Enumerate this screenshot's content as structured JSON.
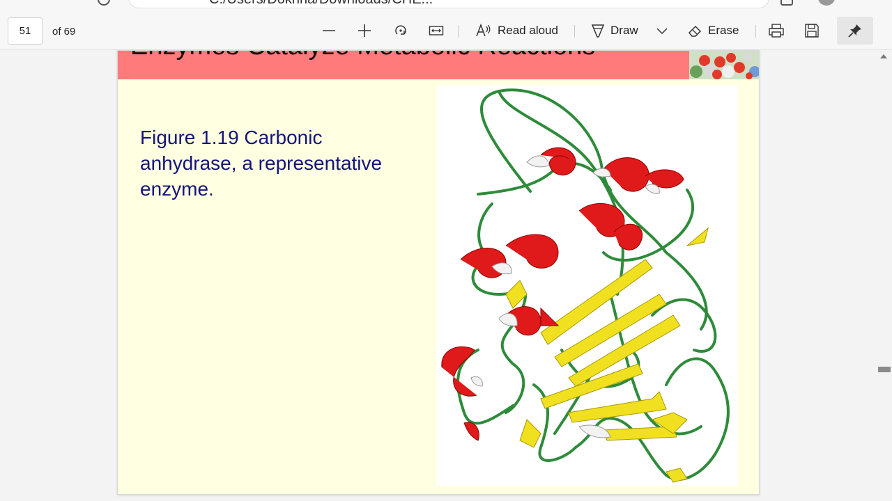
{
  "browser": {
    "address_fragment": "C:/Users/Dokhna/Downloads/CHE..."
  },
  "toolbar": {
    "page_number": "51",
    "page_total": "of 69",
    "read_aloud_label": "Read aloud",
    "draw_label": "Draw",
    "erase_label": "Erase"
  },
  "slide": {
    "title": "Enzymes Catalyze Metabolic Reactions",
    "caption": "Figure 1.19  Carbonic\nanhydrase, a representative\nenzyme."
  },
  "colors": {
    "header": "#ff7b7b",
    "slide_bg": "#ffffe1",
    "caption_text": "#14147a",
    "helix": "#e01a1a",
    "strand": "#f0e020",
    "coil": "#2e8b3a"
  }
}
